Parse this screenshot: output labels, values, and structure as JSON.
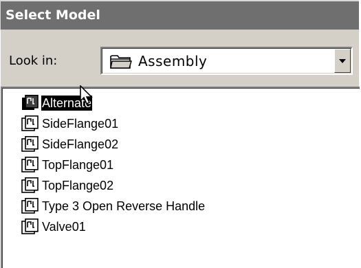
{
  "dialog": {
    "title": "Select Model"
  },
  "look_in": {
    "label": "Look in:",
    "value": "Assembly",
    "icon": "folder-icon"
  },
  "files": [
    {
      "name": "Alternate",
      "selected": true,
      "icon": "model-icon"
    },
    {
      "name": "SideFlange01",
      "selected": false,
      "icon": "model-icon"
    },
    {
      "name": "SideFlange02",
      "selected": false,
      "icon": "model-icon"
    },
    {
      "name": "TopFlange01",
      "selected": false,
      "icon": "model-icon"
    },
    {
      "name": "TopFlange02",
      "selected": false,
      "icon": "model-icon"
    },
    {
      "name": "Type 3 Open Reverse Handle",
      "selected": false,
      "icon": "model-icon"
    },
    {
      "name": "Valve01",
      "selected": false,
      "icon": "model-icon"
    }
  ],
  "colors": {
    "title_bar": "#6f6f6f",
    "dialog_face": "#d4d0c8",
    "selection": "#000000"
  }
}
